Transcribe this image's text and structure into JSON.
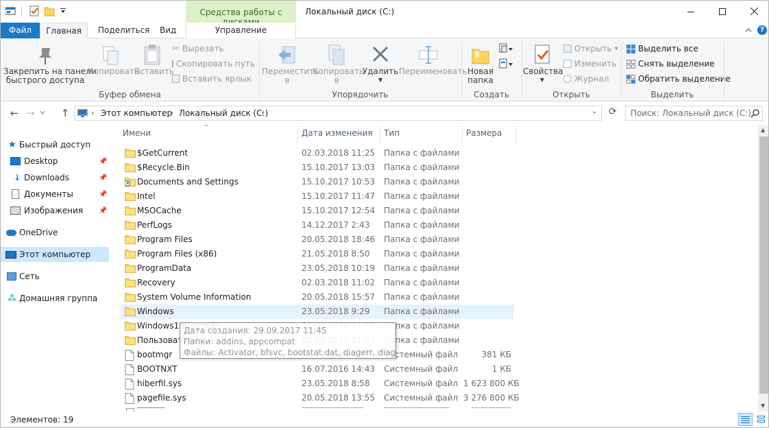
{
  "title": {
    "context_tab": "Средства работы с дисками",
    "window_title": "Локальный диск (C:)"
  },
  "tabs": {
    "file": "Файл",
    "home": "Главная",
    "share": "Поделиться",
    "view": "Вид",
    "manage": "Управление"
  },
  "ribbon": {
    "clipboard": {
      "pin_line1": "Закрепить на панели",
      "pin_line2": "быстрого доступа",
      "copy": "Копировать",
      "paste": "Вставить",
      "cut": "Вырезать",
      "copy_path": "Скопировать путь",
      "paste_shortcut": "Вставить ярлык",
      "label": "Буфер обмена"
    },
    "organize": {
      "move_line1": "Переместить",
      "move_line2": "в",
      "copy_line1": "Копировать",
      "copy_line2": "в",
      "delete": "Удалить",
      "rename": "Переименовать",
      "label": "Упорядочить"
    },
    "create": {
      "new_folder_line1": "Новая",
      "new_folder_line2": "папка",
      "label": "Создать"
    },
    "open": {
      "properties": "Свойства",
      "open": "Открыть",
      "edit": "Изменить",
      "history": "Журнал",
      "label": "Открыть"
    },
    "select": {
      "select_all": "Выделить все",
      "select_none": "Снять выделение",
      "invert": "Обратить выделение",
      "label": "Выделить"
    }
  },
  "address": {
    "crumbs": [
      "Этот компьютер",
      "Локальный диск (C:)"
    ],
    "search_placeholder": "Поиск: Локальный диск (C:)"
  },
  "nav": {
    "quick_access": "Быстрый доступ",
    "desktop": "Desktop",
    "downloads": "Downloads",
    "documents": "Документы",
    "pictures": "Изображения",
    "onedrive": "OneDrive",
    "this_pc": "Этот компьютер",
    "network": "Сеть",
    "homegroup": "Домашняя группа"
  },
  "columns": {
    "name": "Имени",
    "date": "Дата изменения",
    "type": "Тип",
    "size": "Размера"
  },
  "files": [
    {
      "name": "$GetCurrent",
      "date": "02.03.2018 11:25",
      "type": "Папка с файлами",
      "size": "",
      "icon": "folder"
    },
    {
      "name": "$Recycle.Bin",
      "date": "15.10.2017 13:03",
      "type": "Папка с файлами",
      "size": "",
      "icon": "folder"
    },
    {
      "name": "Documents and Settings",
      "date": "15.10.2017 10:53",
      "type": "Папка с файлами",
      "size": "",
      "icon": "folder-link"
    },
    {
      "name": "Intel",
      "date": "15.10.2017 11:47",
      "type": "Папка с файлами",
      "size": "",
      "icon": "folder"
    },
    {
      "name": "MSOCache",
      "date": "15.10.2017 12:54",
      "type": "Папка с файлами",
      "size": "",
      "icon": "folder"
    },
    {
      "name": "PerfLogs",
      "date": "14.12.2017 2:43",
      "type": "Папка с файлами",
      "size": "",
      "icon": "folder"
    },
    {
      "name": "Program Files",
      "date": "20.05.2018 18:46",
      "type": "Папка с файлами",
      "size": "",
      "icon": "folder"
    },
    {
      "name": "Program Files (x86)",
      "date": "21.05.2018 8:50",
      "type": "Папка с файлами",
      "size": "",
      "icon": "folder"
    },
    {
      "name": "ProgramData",
      "date": "23.05.2018 10:19",
      "type": "Папка с файлами",
      "size": "",
      "icon": "folder"
    },
    {
      "name": "Recovery",
      "date": "02.03.2018 11:02",
      "type": "Папка с файлами",
      "size": "",
      "icon": "folder"
    },
    {
      "name": "System Volume Information",
      "date": "20.05.2018 15:57",
      "type": "Папка с файлами",
      "size": "",
      "icon": "folder"
    },
    {
      "name": "Windows",
      "date": "23.05.2018 9:29",
      "type": "Папка с файлами",
      "size": "",
      "icon": "folder"
    },
    {
      "name": "Windows10Upgrade",
      "date": "20.05.2018 11:26",
      "type": "Папка с файлами",
      "size": "",
      "icon": "folder"
    },
    {
      "name": "Пользователи",
      "date": "02.03.2018 11:03",
      "type": "Папка с файлами",
      "size": "",
      "icon": "folder"
    },
    {
      "name": "bootmgr",
      "date": "21.11.2016 4:23",
      "type": "Системный файл",
      "size": "381 КБ",
      "icon": "file"
    },
    {
      "name": "BOOTNXT",
      "date": "16.07.2016 14:43",
      "type": "Системный файл",
      "size": "1 КБ",
      "icon": "file"
    },
    {
      "name": "hiberfil.sys",
      "date": "23.05.2018 8:58",
      "type": "Системный файл",
      "size": "1 623 800 КБ",
      "icon": "file"
    },
    {
      "name": "pagefile.sys",
      "date": "20.05.2018 13:55",
      "type": "Системный файл",
      "size": "3 276 800 КБ",
      "icon": "file"
    }
  ],
  "tooltip": {
    "line1": "Дата создания: 29.09.2017 11:45",
    "line2": "Папки: addins, appcompat",
    "line3": "Файлы: Activator, bfsvc, bootstat.dat, diagerr, diagwrn,"
  },
  "status": {
    "items": "Элементов: 19"
  },
  "colors": {
    "accent": "#1979ca",
    "context_tab": "#ddf1c8",
    "selection": "#cce8ff",
    "hover_row": "#e5f3ff",
    "folder": "#ffd35c"
  }
}
